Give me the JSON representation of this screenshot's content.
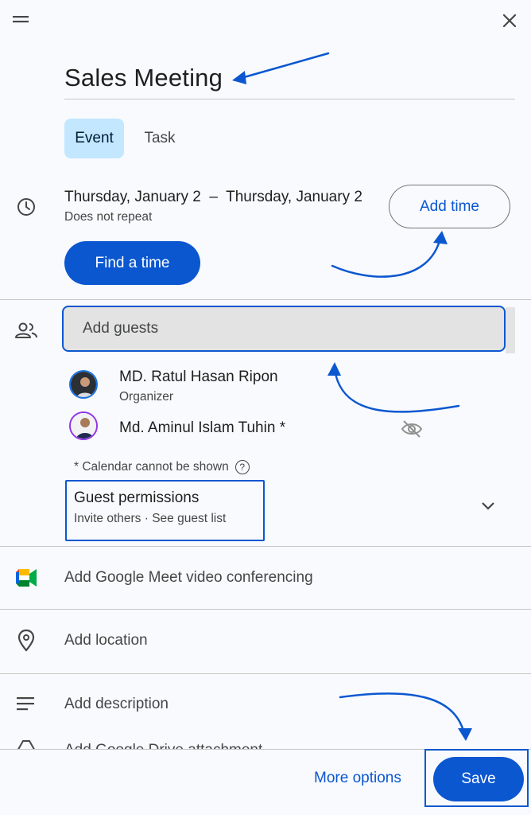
{
  "header": {
    "drag_icon": "drag-handle-icon",
    "close_icon": "close-icon"
  },
  "event": {
    "title": "Sales Meeting",
    "tabs": [
      {
        "label": "Event",
        "selected": true
      },
      {
        "label": "Task",
        "selected": false
      }
    ],
    "date_range": "Thursday, January 2  –  Thursday, January 2",
    "repeat": "Does not repeat",
    "add_time_label": "Add time",
    "find_time_label": "Find a time"
  },
  "guests": {
    "placeholder": "Add guests",
    "list": [
      {
        "name": "MD. Ratul Hasan Ripon",
        "role": "Organizer"
      },
      {
        "name": "Md. Aminul Islam Tuhin *",
        "role": ""
      }
    ],
    "calendar_note": "* Calendar cannot be shown",
    "help_glyph": "?",
    "permissions_title": "Guest permissions",
    "permissions_detail": "Invite others · See guest list"
  },
  "rows": {
    "meet": "Add Google Meet video conferencing",
    "location": "Add location",
    "description": "Add description",
    "attachment_partial": "Add Google Drive attachment"
  },
  "footer": {
    "more_options": "More options",
    "save": "Save"
  },
  "colors": {
    "accent": "#0b57d0",
    "tab_selected_bg": "#c2e7ff",
    "background": "#f8fafd"
  }
}
